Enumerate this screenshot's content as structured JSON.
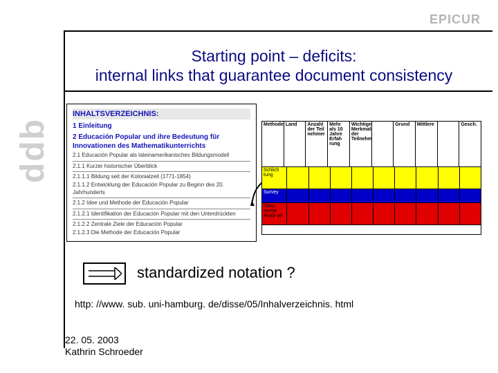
{
  "epicur": "EPICUR",
  "logo": "ddb",
  "title": {
    "line1": "Starting point – deficits:",
    "line2": "internal links that guarantee document consistency"
  },
  "toc": {
    "head": "INHALTSVERZEICHNIS:",
    "s1": "1 Einleitung",
    "s2": "2 Educación Popular und ihre Bedeutung für Innovationen des Mathematikunterrichts",
    "l1": "2.1 Educación Popular als lateinamerikanisches Bildungsmodell",
    "l2": "2.1.1 Kurzer historischer Überblick",
    "l3": "2.1.1.1 Bildung seit der Kolonialzeit (1771-1854)",
    "l4": "2.1.1.2 Entwicklung der Educación Popular zu Beginn des 20. Jahrhunderts",
    "l5": "2.1.2 Idee und Methode der Educación Popular",
    "l6": "2.1.2.1 Identifikation der Educación Popular mit den Unterdrückten",
    "l7": "2.1.2.2 Zentrale Ziele der Educación Popular",
    "l8": "2.1.2.3 Die Methode der Educación Popular"
  },
  "table": {
    "h0": "Methode",
    "h1": "Land",
    "h2": "Anzahl der Teil nehmer",
    "h3": "Mehr als 10 Jahre Erfah rung",
    "h4": "Wichtige Merkmale der Teilnehmer",
    "h5": "",
    "h6": "Grund",
    "h7": "Mittlere",
    "h8": "",
    "h9": "Gesch.",
    "y1": "Schlich tung",
    "b1": "Survey",
    "r1": "Doku mente Analy se"
  },
  "notation": "standardized notation ?",
  "url": "http: //www. sub. uni-hamburg. de/disse/05/Inhalverzeichnis. html",
  "footer": {
    "date": "22. 05. 2003",
    "author": "Kathrin Schroeder"
  }
}
